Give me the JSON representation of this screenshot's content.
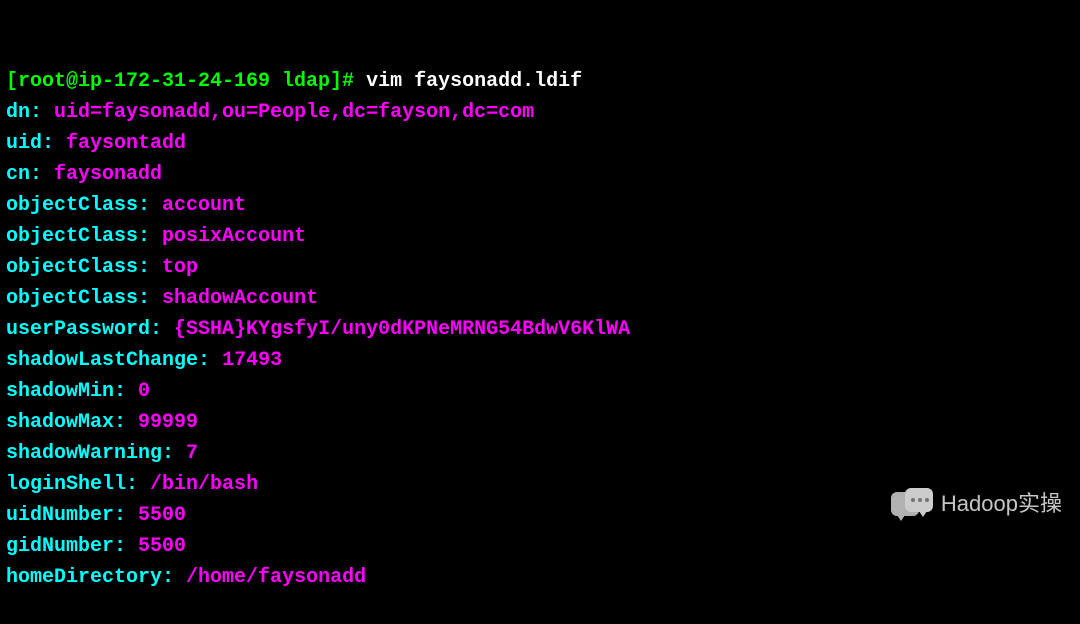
{
  "prompt": {
    "user_host": "[root@ip-172-31-24-169 ldap]#",
    "command": "vim faysonadd.ldif"
  },
  "ldif": {
    "entries": [
      {
        "key": "dn:",
        "value": "uid=faysonadd,ou=People,dc=fayson,dc=com"
      },
      {
        "key": "uid:",
        "value": "faysontadd"
      },
      {
        "key": "cn:",
        "value": "faysonadd"
      },
      {
        "key": "objectClass:",
        "value": "account"
      },
      {
        "key": "objectClass:",
        "value": "posixAccount"
      },
      {
        "key": "objectClass:",
        "value": "top"
      },
      {
        "key": "objectClass:",
        "value": "shadowAccount"
      },
      {
        "key": "userPassword:",
        "value": "{SSHA}KYgsfyI/uny0dKPNeMRNG54BdwV6KlWA"
      },
      {
        "key": "shadowLastChange:",
        "value": "17493"
      },
      {
        "key": "shadowMin:",
        "value": "0"
      },
      {
        "key": "shadowMax:",
        "value": "99999"
      },
      {
        "key": "shadowWarning:",
        "value": "7"
      },
      {
        "key": "loginShell:",
        "value": "/bin/bash"
      },
      {
        "key": "uidNumber:",
        "value": "5500"
      },
      {
        "key": "gidNumber:",
        "value": "5500"
      },
      {
        "key": "homeDirectory:",
        "value": "/home/faysonadd"
      }
    ]
  },
  "watermark": {
    "text": "Hadoop实操"
  }
}
